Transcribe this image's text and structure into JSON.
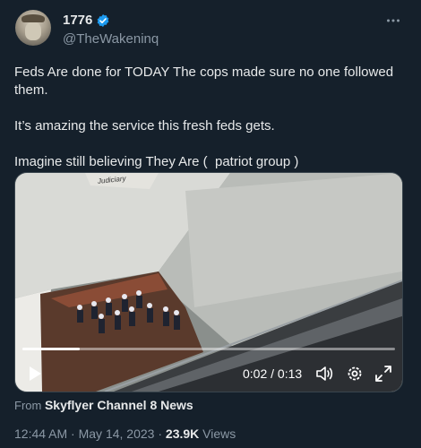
{
  "author": {
    "display_name": "1776",
    "handle": "@TheWakeninq",
    "verified_icon": "verified-badge-icon",
    "verified_color": "#1d9bf0"
  },
  "more_icon": "more-options-icon",
  "tweet": {
    "paragraphs": [
      "Feds Are done for TODAY The cops made sure no one followed them.",
      "It’s amazing the service this fresh feds gets.",
      "Imagine still believing They Are (  patriot group )"
    ]
  },
  "video": {
    "time_display": "0:02 / 0:13",
    "progress_fraction": 0.154,
    "sign_text": "Judiciary",
    "controls": [
      "play-icon",
      "volume-icon",
      "settings-icon",
      "fullscreen-icon"
    ]
  },
  "attribution": {
    "prefix": "From",
    "source": "Skyflyer Channel 8 News"
  },
  "meta": {
    "time": "12:44 AM",
    "separator": "·",
    "date": "May 14, 2023",
    "views_count": "23.9K",
    "views_label": "Views"
  },
  "colors": {
    "background": "#15202b",
    "text": "#e7e9ea",
    "secondary": "#8b98a5",
    "accent": "#1d9bf0"
  }
}
